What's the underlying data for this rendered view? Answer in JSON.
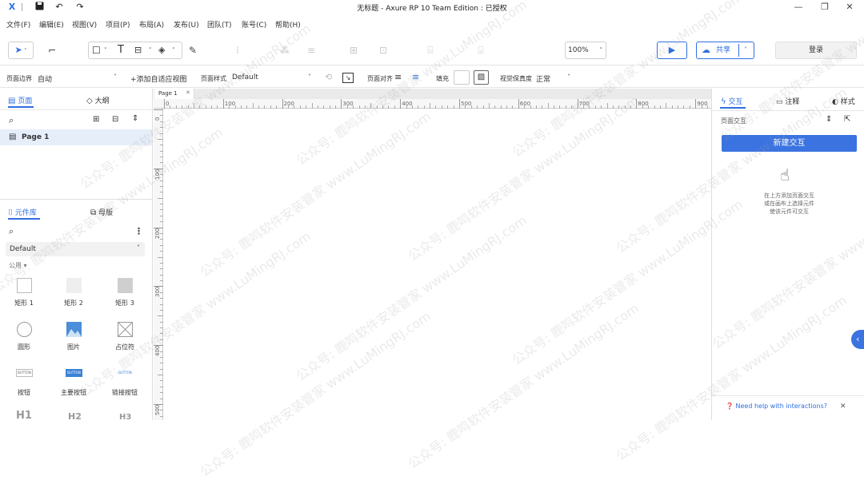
{
  "titlebar": {
    "title": "无标题 - Axure RP 10 Team Edition : 已授权",
    "icons": [
      "app-x-icon",
      "save-icon",
      "undo-icon",
      "redo-icon"
    ],
    "window_buttons": [
      "minimize-icon",
      "restore-icon",
      "close-icon"
    ]
  },
  "menu": [
    "文件(F)",
    "编辑(E)",
    "视图(V)",
    "项目(P)",
    "布局(A)",
    "发布(U)",
    "团队(T)",
    "账号(C)",
    "帮助(H)"
  ],
  "toolbar": {
    "zoom": "100%",
    "share_label": "共享",
    "login_label": "登录"
  },
  "propbar": {
    "page_bound_label": "页面边界",
    "page_bound_value": "自动",
    "add_adaptive": "+添加自适应视图",
    "page_style_label": "页面样式",
    "page_style_value": "Default",
    "page_align_label": "页面对齐",
    "fill_label": "填充",
    "fidelity_label": "视觉保真度",
    "fidelity_value": "正常"
  },
  "left": {
    "pages_tab": "页面",
    "outline_tab": "大纲",
    "page_item": "Page 1",
    "library_tab": "元件库",
    "masters_tab": "母版",
    "library_select": "Default",
    "group_label": "公用 ▾",
    "widgets": [
      "矩形 1",
      "矩形 2",
      "矩形 3",
      "圆形",
      "图片",
      "占位符",
      "按钮",
      "主要按钮",
      "链接按钮"
    ],
    "button_previews": [
      "BUTTON",
      "BUTTON",
      "BUTTON"
    ],
    "headings": [
      "H1",
      "H2",
      "H3"
    ]
  },
  "canvas": {
    "tab_label": "Page 1",
    "ruler_ticks": [
      "0",
      "100",
      "200",
      "300",
      "400",
      "500",
      "600",
      "700",
      "800",
      "900"
    ],
    "vruler_ticks": [
      "0",
      "100",
      "200",
      "300",
      "400",
      "500"
    ]
  },
  "right": {
    "interaction_tab": "交互",
    "notes_tab": "注释",
    "style_tab": "样式",
    "page_interaction_label": "页面交互",
    "new_interaction_btn": "新建交互",
    "hint_line1": "在上方添加页面交互",
    "hint_line2": "或在画布上选择元件",
    "hint_line3": "使该元件可交互",
    "help_link": "Need help with interactions?"
  },
  "watermark_text": "公众号: 鹿鸣软件安装管家  www.LuMingRJ.com",
  "colors": {
    "accent": "#2f6fdf",
    "new_btn_bg": "#3b73e0",
    "selected_row": "#e6eefa"
  }
}
